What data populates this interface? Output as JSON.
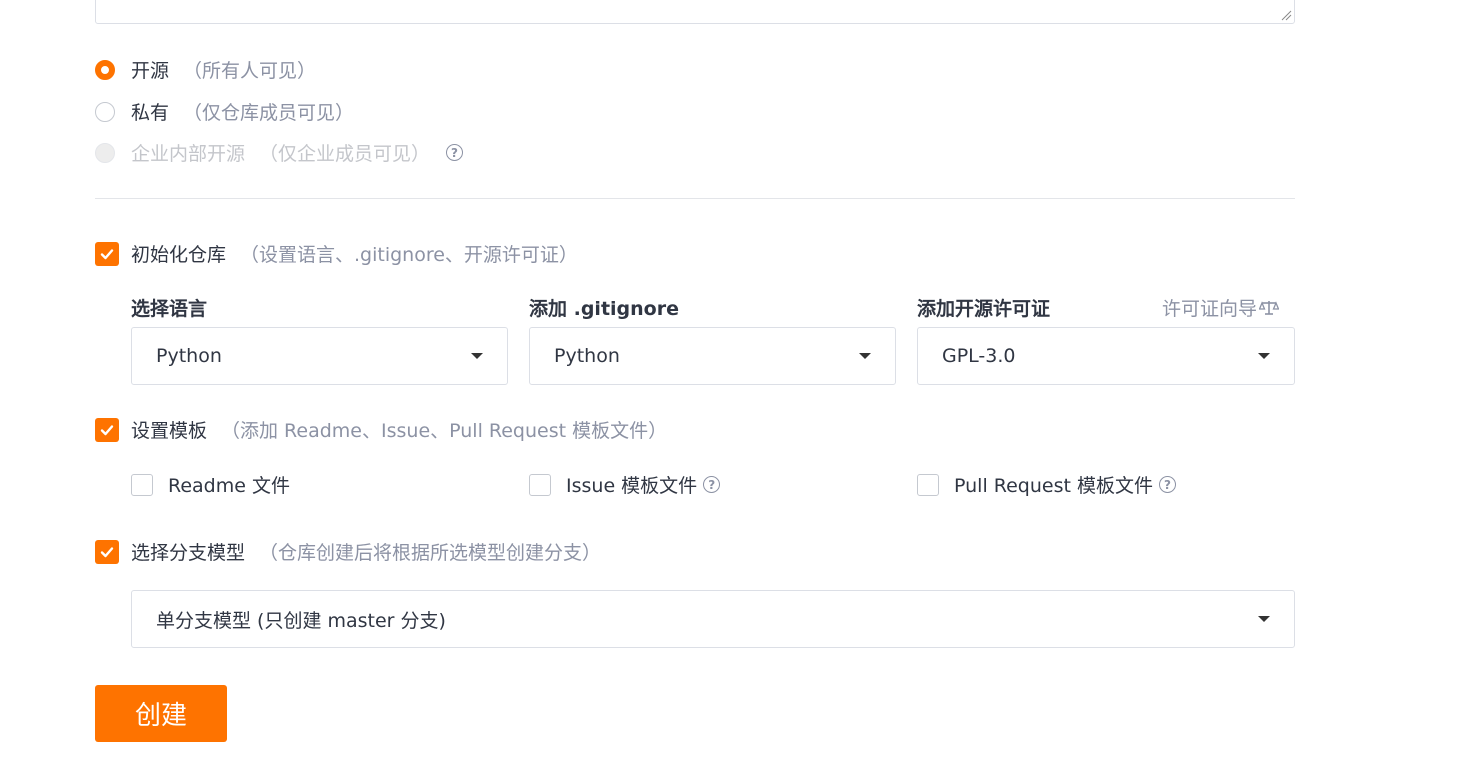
{
  "visibility": {
    "options": [
      {
        "label": "开源",
        "hint": "（所有人可见）",
        "state": "selected"
      },
      {
        "label": "私有",
        "hint": "（仅仓库成员可见）",
        "state": "unselected"
      },
      {
        "label": "企业内部开源",
        "hint": "（仅企业成员可见）",
        "state": "disabled"
      }
    ],
    "help_icon": "?"
  },
  "init_repo": {
    "checked": true,
    "label": "初始化仓库",
    "hint": "（设置语言、.gitignore、开源许可证）",
    "language": {
      "label": "选择语言",
      "value": "Python"
    },
    "gitignore": {
      "label": "添加 .gitignore",
      "value": "Python"
    },
    "license": {
      "label": "添加开源许可证",
      "value": "GPL-3.0",
      "guide_label": "许可证向导"
    }
  },
  "templates": {
    "checked": true,
    "label": "设置模板",
    "hint": "（添加 Readme、Issue、Pull Request 模板文件）",
    "items": [
      {
        "label": "Readme 文件",
        "checked": false
      },
      {
        "label": "Issue 模板文件",
        "checked": false
      },
      {
        "label": "Pull Request 模板文件",
        "checked": false
      }
    ]
  },
  "branch_model": {
    "checked": true,
    "label": "选择分支模型",
    "hint": "（仓库创建后将根据所选模型创建分支）",
    "value": "单分支模型 (只创建 master 分支)"
  },
  "create_button": {
    "label": "创建"
  },
  "colors": {
    "accent": "#fe7300",
    "muted": "#8c92a4",
    "border": "#dcdfe6"
  },
  "icons": [
    "question-circle-icon",
    "scale-icon",
    "check-icon",
    "caret-down-icon",
    "resize-grip-icon"
  ]
}
